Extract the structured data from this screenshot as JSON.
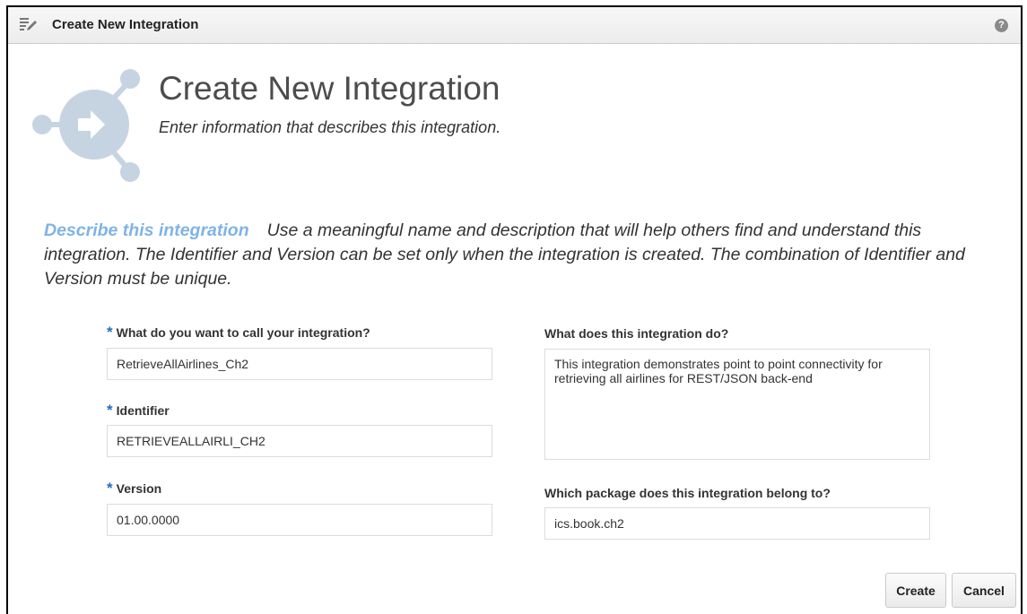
{
  "titlebar": {
    "title": "Create New Integration",
    "help_icon": "help-icon",
    "help_symbol": "?"
  },
  "header": {
    "title": "Create New Integration",
    "subtitle": "Enter information that describes this integration."
  },
  "describe": {
    "heading": "Describe this integration",
    "text": "Use a meaningful name and description that will help others find and understand this integration. The Identifier and Version can be set only when the integration is created. The combination of Identifier and Version must be unique."
  },
  "form": {
    "required_mark": "*",
    "name_label": "What do you want to call your integration?",
    "name_value": "RetrieveAllAirlines_Ch2",
    "identifier_label": "Identifier",
    "identifier_value": "RETRIEVEALLAIRLI_CH2",
    "version_label": "Version",
    "version_value": "01.00.0000",
    "description_label": "What does this integration do?",
    "description_value": "This integration demonstrates point to point connectivity for retrieving all airlines for REST/JSON back-end",
    "package_label": "Which package does this integration belong to?",
    "package_value": "ics.book.ch2"
  },
  "buttons": {
    "create": "Create",
    "cancel": "Cancel"
  },
  "colors": {
    "accent_blue": "#7fb3e6",
    "required_blue": "#1f6fc5",
    "icon_gray": "#c6d4e2"
  }
}
